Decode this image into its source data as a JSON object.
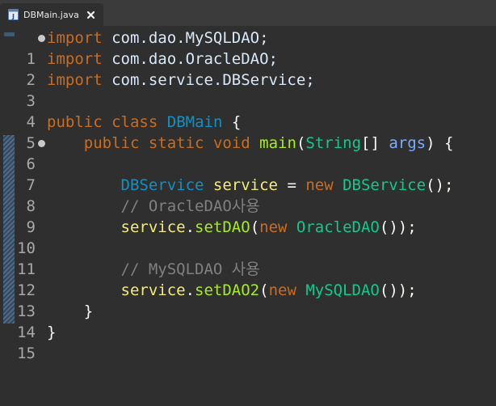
{
  "tab": {
    "filename": "DBMain.java",
    "icon": "java-file-icon",
    "close": "close-icon"
  },
  "colors": {
    "background": "#2f2f2f",
    "keyword": "#cc6c1d",
    "class_name": "#1290c3",
    "type": "#12c88b",
    "variable": "#f3ec79",
    "method": "#a7ec21",
    "comment": "#808080",
    "default": "#d9e8f7"
  },
  "lines": [
    {
      "num": "1",
      "import_kw": "import",
      "path": " com.dao.MySQLDAO;"
    },
    {
      "num": "2",
      "import_kw": "import",
      "path": " com.dao.OracleDAO;"
    },
    {
      "num": "3",
      "import_kw": "import",
      "path": " com.service.DBService;"
    },
    {
      "num": "4"
    },
    {
      "num": "5",
      "kw_public": "public",
      "kw_class": "class",
      "class_name": "DBMain",
      "open": " {"
    },
    {
      "num": "6",
      "kw_public": "public",
      "kw_static": "static",
      "kw_void": "void",
      "method": "main",
      "lp": "(",
      "type": "String",
      "arr": "[] ",
      "param": "args",
      "rp": ") {"
    },
    {
      "num": "7"
    },
    {
      "num": "8",
      "type": "DBService",
      "var": "service",
      "assign": " = ",
      "kw_new": "new",
      "ctor": "DBService",
      "end": "();"
    },
    {
      "num": "9",
      "comment": "// OracleDAO사용"
    },
    {
      "num": "10",
      "var": "service",
      "dot": ".",
      "method": "setDAO",
      "lp": "(",
      "kw_new": "new",
      "ctor": "OracleDAO",
      "end": "());"
    },
    {
      "num": "11"
    },
    {
      "num": "12",
      "comment": "// MySQLDAO 사용"
    },
    {
      "num": "13",
      "var": "service",
      "dot": ".",
      "method": "setDAO2",
      "lp": "(",
      "kw_new": "new",
      "ctor": "MySQLDAO",
      "end": "());"
    },
    {
      "num": "14",
      "close": "}"
    },
    {
      "num": "15",
      "close": "}"
    }
  ]
}
